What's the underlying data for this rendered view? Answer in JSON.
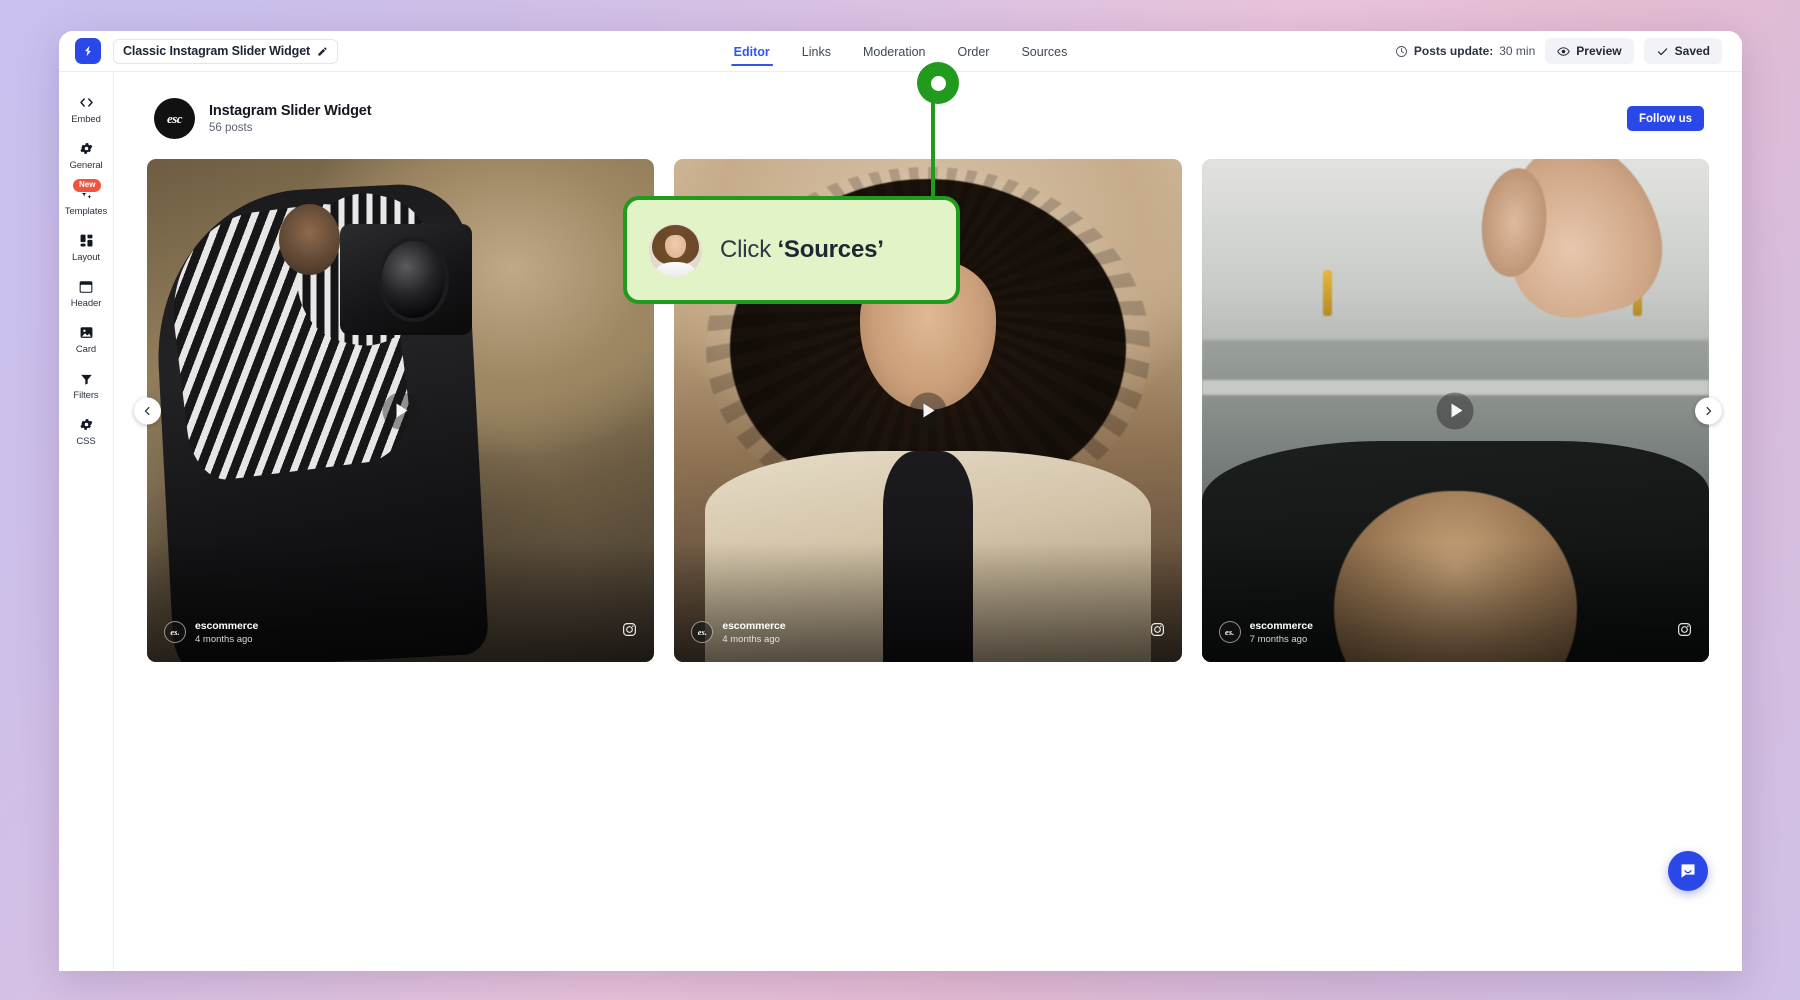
{
  "topbar": {
    "logo_icon": "elfsight-logo-icon",
    "widget_title": "Classic Instagram Slider Widget",
    "edit_icon": "pencil-icon",
    "tabs": [
      {
        "label": "Editor",
        "active": true
      },
      {
        "label": "Links",
        "active": false
      },
      {
        "label": "Moderation",
        "active": false
      },
      {
        "label": "Order",
        "active": false
      },
      {
        "label": "Sources",
        "active": false
      }
    ],
    "posts_update_icon": "clock-icon",
    "posts_update_label": "Posts update:",
    "posts_update_value": "30 min",
    "preview_button": "Preview",
    "preview_icon": "eye-icon",
    "saved_button": "Saved",
    "saved_icon": "check-icon"
  },
  "sidebar": {
    "items": [
      {
        "label": "Embed",
        "icon": "code-icon",
        "badge": ""
      },
      {
        "label": "General",
        "icon": "gear-icon",
        "badge": ""
      },
      {
        "label": "Templates",
        "icon": "sparkle-icon",
        "badge": "New"
      },
      {
        "label": "Layout",
        "icon": "layout-icon",
        "badge": ""
      },
      {
        "label": "Header",
        "icon": "header-icon",
        "badge": ""
      },
      {
        "label": "Card",
        "icon": "image-icon",
        "badge": ""
      },
      {
        "label": "Filters",
        "icon": "filter-icon",
        "badge": ""
      },
      {
        "label": "CSS",
        "icon": "gear-icon",
        "badge": ""
      }
    ]
  },
  "widget": {
    "avatar_text": "esc",
    "title": "Instagram Slider Widget",
    "posts_count": "56 posts",
    "follow_button": "Follow us",
    "prev_icon": "chevron-left-icon",
    "next_icon": "chevron-right-icon",
    "cards": [
      {
        "username": "escommerce",
        "time": "4 months ago",
        "avatar_text": "es.",
        "source_icon": "instagram-icon",
        "media": "video"
      },
      {
        "username": "escommerce",
        "time": "4 months ago",
        "avatar_text": "es.",
        "source_icon": "instagram-icon",
        "media": "video"
      },
      {
        "username": "escommerce",
        "time": "7 months ago",
        "avatar_text": "es.",
        "source_icon": "instagram-icon",
        "media": "video"
      }
    ]
  },
  "coachmark": {
    "text_prefix": "Click ",
    "text_emphasis": "‘Sources’",
    "avatar": "assistant-avatar",
    "accent_color": "#229a1e",
    "bubble_color": "#e2f3c8"
  },
  "chat": {
    "icon": "chat-bubble-icon",
    "color": "#2a48e8"
  }
}
